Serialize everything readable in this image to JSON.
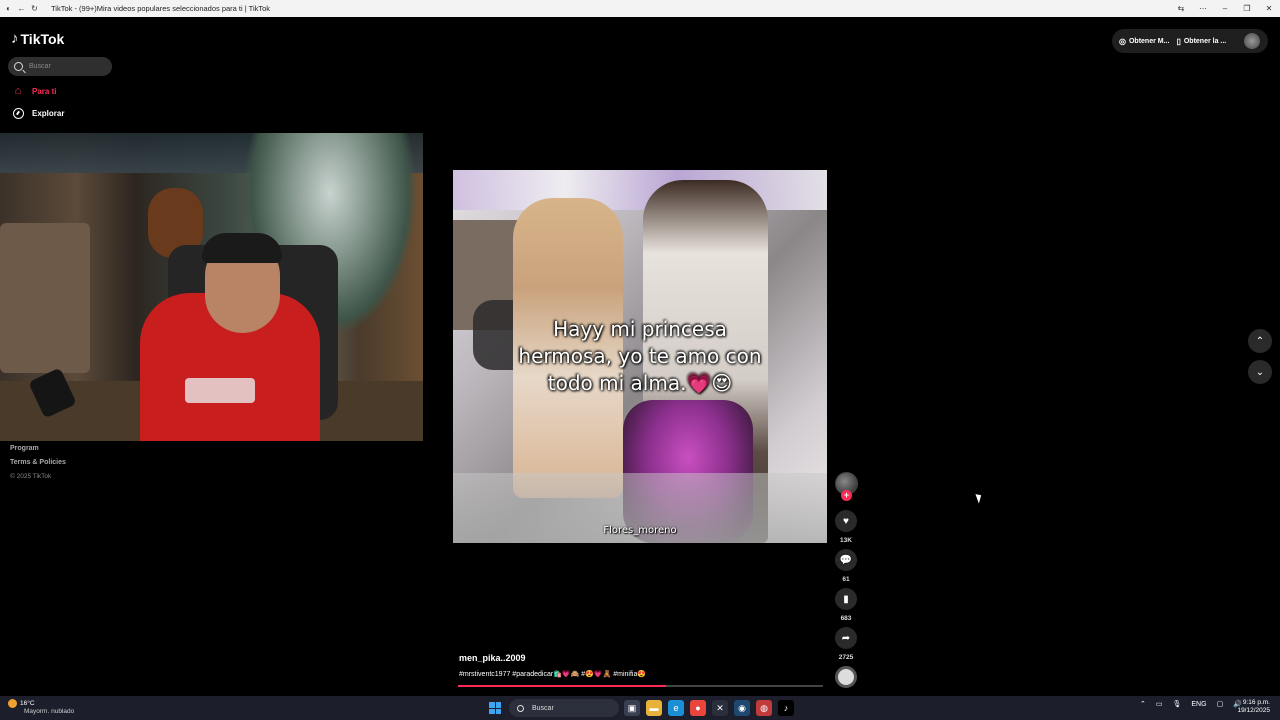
{
  "browser": {
    "title": "TikTok - (99+)Mira videos populares seleccionados para ti | TikTok"
  },
  "sidebar": {
    "logo": "TikTok",
    "search_placeholder": "Buscar",
    "nav": [
      {
        "label": "Para ti",
        "icon": "home-icon",
        "active": true
      },
      {
        "label": "Explorar",
        "icon": "compass-icon",
        "active": false
      }
    ],
    "footer": {
      "program": "Program",
      "terms": "Terms & Policies",
      "copyright": "© 2025 TikTok"
    }
  },
  "topbar": {
    "get_coins": "Obtener M...",
    "get_app": "Obtener la ..."
  },
  "video": {
    "caption_overlay": "Hayy mi princesa\nhermosa, yo te amo con\ntodo mi alma.💗😍",
    "credit": "Flores_moreno",
    "author": "men_pika..2009",
    "description": "#mrstiventc1977 #paradedicar🛍️💗🙈 #😍💗🧸 #minifia😍",
    "progress": 0.57
  },
  "actions": {
    "likes": "13K",
    "comments": "61",
    "saves": "683",
    "shares": "2725"
  },
  "colors": {
    "accent": "#fe2c55",
    "background": "#000000"
  },
  "taskbar": {
    "weather_temp": "16°C",
    "weather_desc": "Mayorm. nublado",
    "search": "Buscar",
    "lang": "ENG",
    "time": "9:16 p.m.",
    "date": "19/12/2025"
  }
}
